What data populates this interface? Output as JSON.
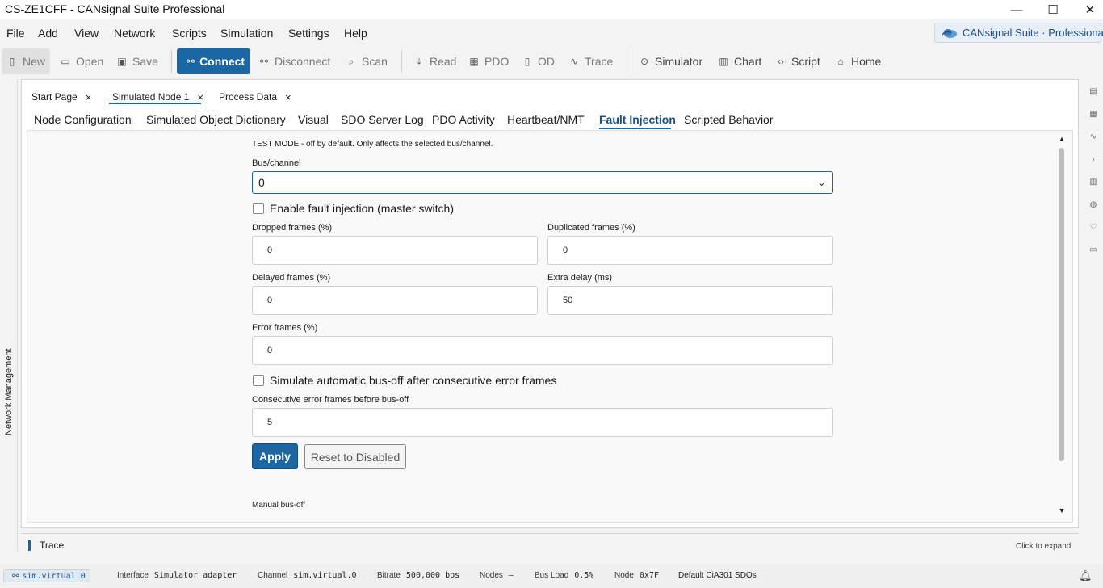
{
  "window": {
    "title": "CS-ZE1CFF - CANsignal Suite Professional",
    "min_glyph": "—",
    "max_glyph": "☐",
    "close_glyph": "✕"
  },
  "menu": [
    "File",
    "Add",
    "View",
    "Network",
    "Scripts",
    "Simulation",
    "Settings",
    "Help"
  ],
  "brand": {
    "label": "CANsignal Suite · Professional",
    "icon": "cloud-logo-icon"
  },
  "toolbar": {
    "new": "New",
    "open": "Open",
    "save": "Save",
    "connect": "Connect",
    "disconnect": "Disconnect",
    "scan": "Scan",
    "read": "Read",
    "pdo": "PDO",
    "od": "OD",
    "trace": "Trace",
    "simulator": "Simulator",
    "chart": "Chart",
    "script": "Script",
    "home": "Home"
  },
  "left_panel": {
    "label": "Network Management"
  },
  "doc_tabs": [
    {
      "label": "Start Page"
    },
    {
      "label": "Simulated Node 1"
    },
    {
      "label": "Process Data"
    }
  ],
  "doc_tab_close": "×",
  "sub_tabs": [
    {
      "label": "Node Configuration"
    },
    {
      "label": "Simulated Object Dictionary"
    },
    {
      "label": "Visual"
    },
    {
      "label": "SDO Server Log"
    },
    {
      "label": "PDO Activity"
    },
    {
      "label": "Heartbeat/NMT"
    },
    {
      "label": "Fault Injection",
      "active": true
    },
    {
      "label": "Scripted Behavior"
    }
  ],
  "fault": {
    "test_mode_note": "TEST MODE - off by default. Only affects the selected bus/channel.",
    "bus_label": "Bus/channel",
    "bus_value": "0",
    "enable_label": "Enable fault injection (master switch)",
    "enable_checked": false,
    "dropped_label": "Dropped frames (%)",
    "dropped_value": "0",
    "duplicated_label": "Duplicated frames (%)",
    "duplicated_value": "0",
    "delayed_label": "Delayed frames (%)",
    "delayed_value": "0",
    "extra_delay_label": "Extra delay (ms)",
    "extra_delay_value": "50",
    "error_label": "Error frames (%)",
    "error_value": "0",
    "busoff_label": "Simulate automatic bus-off after consecutive error frames",
    "busoff_checked": false,
    "consecutive_label": "Consecutive error frames before bus-off",
    "consecutive_value": "5",
    "apply": "Apply",
    "reset": "Reset to Disabled",
    "manual_busoff": "Manual bus-off"
  },
  "trace": {
    "label": "Trace",
    "expand": "Click to expand"
  },
  "status": {
    "interface_chip": "sim.virtual.0",
    "interface_key": "Interface",
    "interface_val": "Simulator adapter",
    "channel_key": "Channel",
    "channel_val": "sim.virtual.0",
    "bitrate_key": "Bitrate",
    "bitrate_val": "500,000 bps",
    "nodes_key": "Nodes",
    "nodes_val": "–",
    "busload_key": "Bus Load",
    "busload_val": "0.5%",
    "node_key": "Node",
    "node_val": "0x7F",
    "sdo_note": "Default CiA301 SDOs"
  },
  "colors": {
    "accent": "#1b66a3",
    "brand_text": "#1a4f8a"
  }
}
